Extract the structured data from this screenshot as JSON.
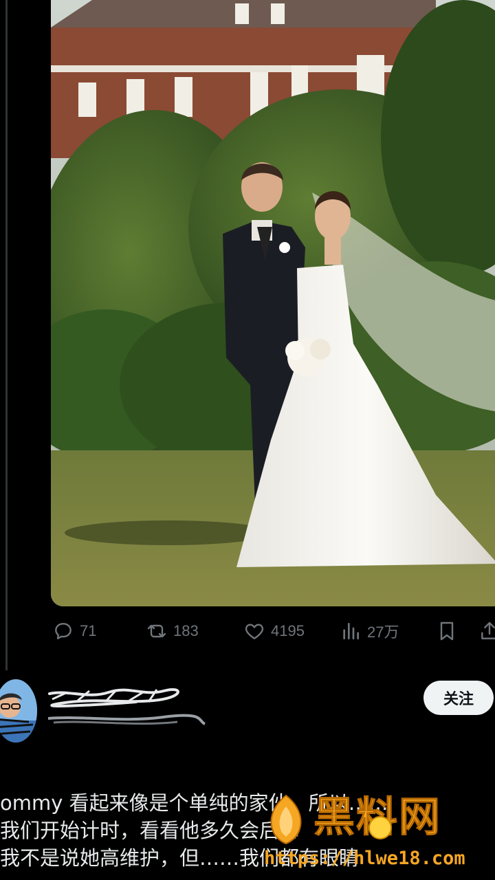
{
  "post": {
    "image_alt": "wedding photo",
    "stats": {
      "replies": "71",
      "retweets": "183",
      "likes": "4195",
      "views": "27万"
    }
  },
  "reply": {
    "follow_label": "关注",
    "lines": [
      "ommy 看起来像是个单纯的家伙，所以……",
      "我们开始计时，看看他多久会后悔",
      "我不是说她高维护，但……我们都有眼睛"
    ]
  },
  "watermark": {
    "title": "黑料网",
    "url": "https://hlwe18.com"
  },
  "colors": {
    "background": "#000000",
    "muted": "#71767b",
    "watermark": "#f5a623"
  }
}
